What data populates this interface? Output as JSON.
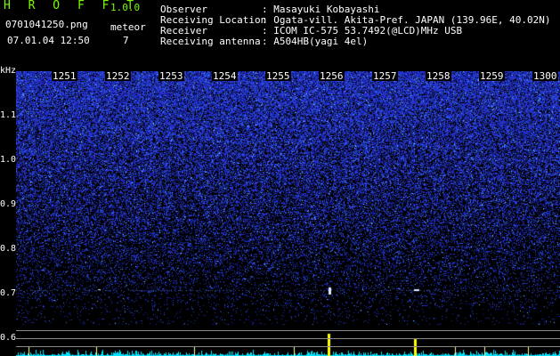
{
  "app": {
    "title": "H R O F F T",
    "version": "1.0.0",
    "file": "0701041250.png",
    "datetime": "07.01.04 12:50",
    "meteor_label": "meteor",
    "meteor_count": "7"
  },
  "info": {
    "observer_key": "Observer",
    "observer_val": ": Masayuki Kobayashi",
    "location_key": "Receiving Location",
    "location_val": ": Ogata-vill. Akita-Pref. JAPAN (139.96E, 40.02N)",
    "receiver_key": "Receiver",
    "receiver_val": ": ICOM IC-575 53.7492(@LCD)MHz USB",
    "antenna_key": "Receiving antenna",
    "antenna_val": ": A504HB(yagi 4el)"
  },
  "axis": {
    "unit": "kHz",
    "y_labels": [
      "1.1",
      "1.0",
      "0.9",
      "0.8",
      "0.7",
      "0.6"
    ],
    "x_labels": [
      "1251",
      "1252",
      "1253",
      "1254",
      "1255",
      "1256",
      "1257",
      "1258",
      "1259",
      "1300"
    ]
  },
  "colors": {
    "background": "#000000",
    "header_green": "#7cfc00",
    "spectrum_blue": "#2040ff",
    "strip_cyan": "#00e5ff",
    "meteor_yellow": "#ffff00"
  }
}
